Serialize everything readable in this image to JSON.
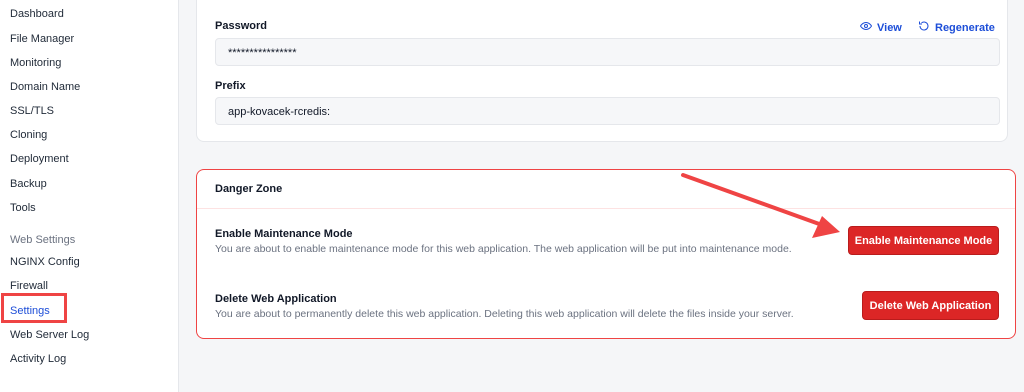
{
  "sidebar": {
    "items": [
      {
        "label": "Dashboard"
      },
      {
        "label": "File Manager"
      },
      {
        "label": "Monitoring"
      },
      {
        "label": "Domain Name"
      },
      {
        "label": "SSL/TLS"
      },
      {
        "label": "Cloning"
      },
      {
        "label": "Deployment"
      },
      {
        "label": "Backup"
      },
      {
        "label": "Tools"
      }
    ],
    "section_label": "Web Settings",
    "section_items": [
      {
        "label": "NGINX Config"
      },
      {
        "label": "Firewall"
      },
      {
        "label": "Settings"
      },
      {
        "label": "Web Server Log"
      },
      {
        "label": "Activity Log"
      }
    ]
  },
  "credentials": {
    "password_label": "Password",
    "password_value": "****************",
    "view_label": "View",
    "regenerate_label": "Regenerate",
    "prefix_label": "Prefix",
    "prefix_value": "app-kovacek-rcredis:"
  },
  "danger_zone": {
    "title": "Danger Zone",
    "maintenance": {
      "title": "Enable Maintenance Mode",
      "description": "You are about to enable maintenance mode for this web application. The web application will be put into maintenance mode.",
      "button_label": "Enable Maintenance Mode"
    },
    "delete": {
      "title": "Delete Web Application",
      "description": "You are about to permanently delete this web application. Deleting this web application will delete the files inside your server.",
      "button_label": "Delete Web Application"
    }
  },
  "colors": {
    "accent": "#1d4ed8",
    "danger": "#dc2626",
    "annotation": "#ef4444"
  }
}
